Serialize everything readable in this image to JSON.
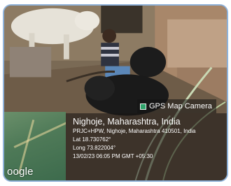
{
  "photo": {
    "description_icon": "farm-scene-photo"
  },
  "map": {
    "logo_text": "oogle"
  },
  "badge": {
    "icon": "gps-map-camera-icon",
    "label": "GPS Map Camera"
  },
  "location": {
    "place": "Nighoje, Maharashtra, India",
    "address": "PRJC+HPW, Nighoje, Maharashtra 410501, India",
    "lat": "Lat 18.730762°",
    "long": "Long 73.822004°",
    "datetime": "13/02/23 06:05 PM GMT +05:30"
  },
  "colors": {
    "frame_border": "#8fb2d9",
    "overlay": "rgba(25,22,20,0.58)",
    "badge_icon": "#2ea36b"
  }
}
